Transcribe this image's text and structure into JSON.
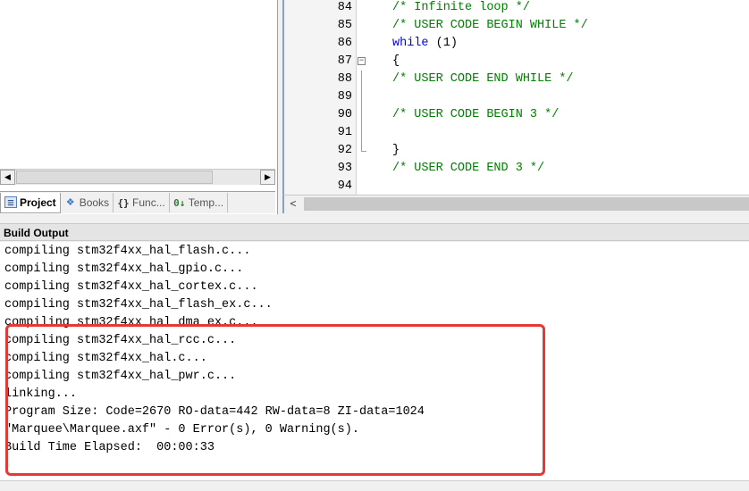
{
  "project_panel": {
    "tabs": [
      {
        "label": "Project",
        "icon": "project-icon"
      },
      {
        "label": "Books",
        "icon": "books-icon"
      },
      {
        "label": "Func...",
        "icon": "functions-icon"
      },
      {
        "label": "Temp...",
        "icon": "templates-icon"
      }
    ]
  },
  "editor": {
    "lines": [
      {
        "num": "84",
        "code": "/* Infinite loop */",
        "type": "comment"
      },
      {
        "num": "85",
        "code": "/* USER CODE BEGIN WHILE */",
        "type": "comment"
      },
      {
        "num": "86",
        "code": "while (1)",
        "type": "keyword"
      },
      {
        "num": "87",
        "code": "{",
        "type": "plain",
        "fold": "open"
      },
      {
        "num": "88",
        "code": "/* USER CODE END WHILE */",
        "type": "comment"
      },
      {
        "num": "89",
        "code": "",
        "type": "plain"
      },
      {
        "num": "90",
        "code": "/* USER CODE BEGIN 3 */",
        "type": "comment"
      },
      {
        "num": "91",
        "code": "",
        "type": "plain"
      },
      {
        "num": "92",
        "code": "}",
        "type": "plain",
        "fold": "end"
      },
      {
        "num": "93",
        "code": "/* USER CODE END 3 */",
        "type": "comment"
      },
      {
        "num": "94",
        "code": "",
        "type": "plain"
      }
    ]
  },
  "build_output": {
    "title": "Build Output",
    "lines": [
      "compiling stm32f4xx_hal_flash.c...",
      "compiling stm32f4xx_hal_gpio.c...",
      "compiling stm32f4xx_hal_cortex.c...",
      "compiling stm32f4xx_hal_flash_ex.c...",
      "compiling stm32f4xx_hal_dma_ex.c...",
      "compiling stm32f4xx_hal_rcc.c...",
      "compiling stm32f4xx_hal.c...",
      "compiling stm32f4xx_hal_pwr.c...",
      "linking...",
      "Program Size: Code=2670 RO-data=442 RW-data=8 ZI-data=1024",
      "\"Marquee\\Marquee.axf\" - 0 Error(s), 0 Warning(s).",
      "Build Time Elapsed:  00:00:33"
    ]
  },
  "colors": {
    "comment": "#008000",
    "keyword": "#0000ff",
    "highlight": "#e53935"
  }
}
